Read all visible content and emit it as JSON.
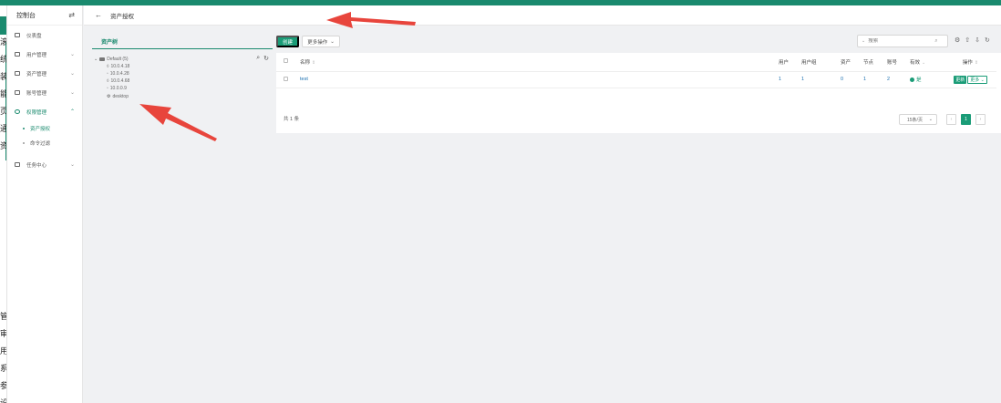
{
  "sidebar": {
    "title": "控制台",
    "menu": [
      {
        "label": "仪表盘",
        "has_children": false
      },
      {
        "label": "用户管理",
        "has_children": true
      },
      {
        "label": "资产管理",
        "has_children": true
      },
      {
        "label": "账号管理",
        "has_children": true
      },
      {
        "label": "权限管理",
        "has_children": true,
        "expanded": true,
        "active": true
      },
      {
        "label": "任务中心",
        "has_children": true
      }
    ],
    "submenu": [
      {
        "label": "资产授权",
        "active": true
      },
      {
        "label": "命令过滤",
        "active": false
      }
    ]
  },
  "left_strip_chars": [
    "滚",
    "统",
    "装",
    "能",
    "页",
    "通",
    "资",
    "管",
    "审",
    "用",
    "系",
    "参",
    "设"
  ],
  "header": {
    "title": "资产授权"
  },
  "tree": {
    "tab": "资产树",
    "root": "Default (5)",
    "nodes": [
      "10.0.4.18",
      "10.0.4.28",
      "10.0.4.68",
      "10.0.0.9",
      "desktop"
    ]
  },
  "toolbar": {
    "create_label": "创建",
    "more_label": "更多操作",
    "search_placeholder": "搜索"
  },
  "table": {
    "columns": [
      "名称",
      "用户",
      "用户组",
      "资产",
      "节点",
      "账号",
      "有效",
      "操作"
    ],
    "rows": [
      {
        "name": "test",
        "users": "1",
        "groups": "1",
        "assets": "0",
        "nodes": "1",
        "accounts": "2",
        "valid": "是",
        "action_update": "更新",
        "action_more": "更多"
      }
    ]
  },
  "pagination": {
    "total": "共 1 条",
    "page_size": "15条/页",
    "current": "1"
  },
  "colors": {
    "brand": "#1a9c77",
    "topbar": "#1a8a6e",
    "annotation_arrow": "#e8453c"
  }
}
